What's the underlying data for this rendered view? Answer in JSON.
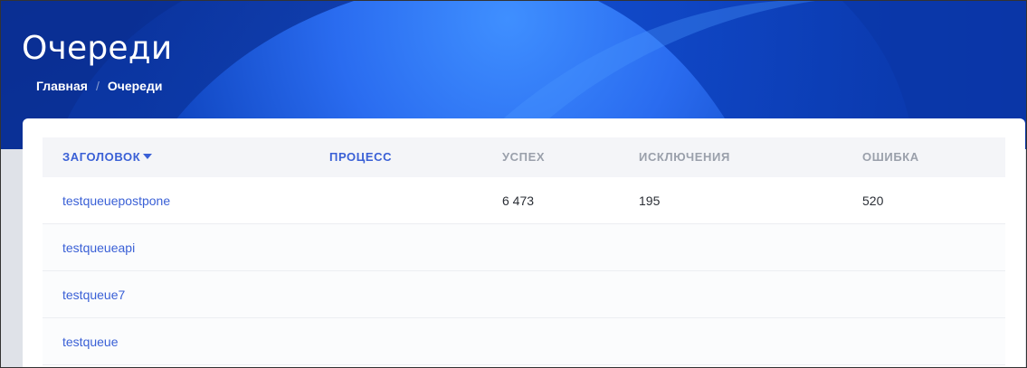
{
  "header": {
    "title": "Очереди",
    "breadcrumb": [
      {
        "label": "Главная"
      },
      {
        "label": "Очереди"
      }
    ],
    "breadcrumb_separator": "/"
  },
  "table": {
    "columns": [
      {
        "label": "Заголовок",
        "sortable": true,
        "sorted": "desc"
      },
      {
        "label": "Процесс",
        "sortable": true
      },
      {
        "label": "Успех",
        "sortable": false
      },
      {
        "label": "Исключения",
        "sortable": false
      },
      {
        "label": "Ошибка",
        "sortable": false
      }
    ],
    "rows": [
      {
        "title": "testqueuepostpone",
        "process": "",
        "success": "6 473",
        "exceptions": "195",
        "errors": "520"
      },
      {
        "title": "testqueueapi",
        "process": "",
        "success": "",
        "exceptions": "",
        "errors": ""
      },
      {
        "title": "testqueue7",
        "process": "",
        "success": "",
        "exceptions": "",
        "errors": ""
      },
      {
        "title": "testqueue",
        "process": "",
        "success": "",
        "exceptions": "",
        "errors": ""
      }
    ]
  },
  "colors": {
    "hero_base": "#0b3fb8",
    "hero_light": "#3a8bff",
    "link": "#3a60d6",
    "header_text_muted": "#9aa0ab"
  },
  "icons": {
    "sort": "caret-down-icon"
  }
}
